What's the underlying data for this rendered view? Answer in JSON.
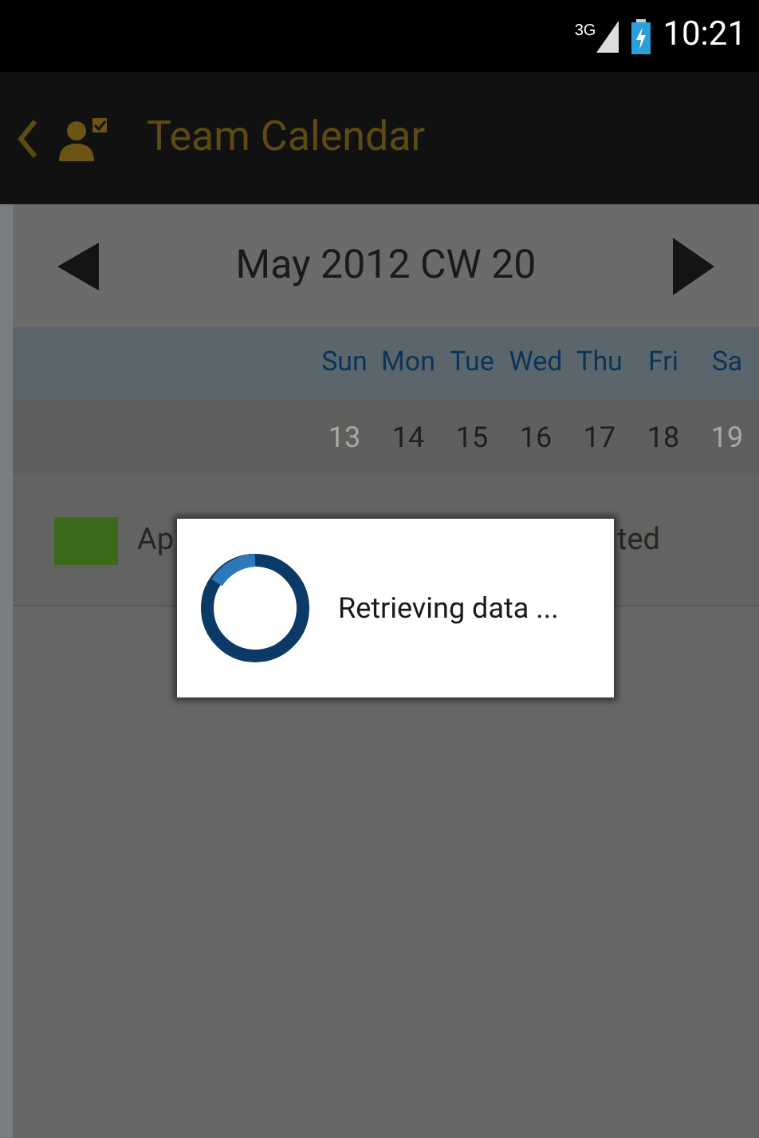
{
  "status_bar": {
    "network": "3G",
    "time": "10:21"
  },
  "action_bar": {
    "title": "Team Calendar"
  },
  "week_nav": {
    "label": "May 2012 CW 20"
  },
  "weekdays": [
    "Sun",
    "Mon",
    "Tue",
    "Wed",
    "Thu",
    "Fri",
    "Sa"
  ],
  "dates": [
    {
      "day": "13",
      "disabled": true
    },
    {
      "day": "14",
      "disabled": false
    },
    {
      "day": "15",
      "disabled": false
    },
    {
      "day": "16",
      "disabled": false
    },
    {
      "day": "17",
      "disabled": false
    },
    {
      "day": "18",
      "disabled": false
    },
    {
      "day": "19",
      "disabled": true
    }
  ],
  "legend": [
    {
      "color": "#3c6a1c",
      "text_left": "Ap",
      "text_right": "ted"
    }
  ],
  "dialog": {
    "message": "Retrieving data ..."
  }
}
